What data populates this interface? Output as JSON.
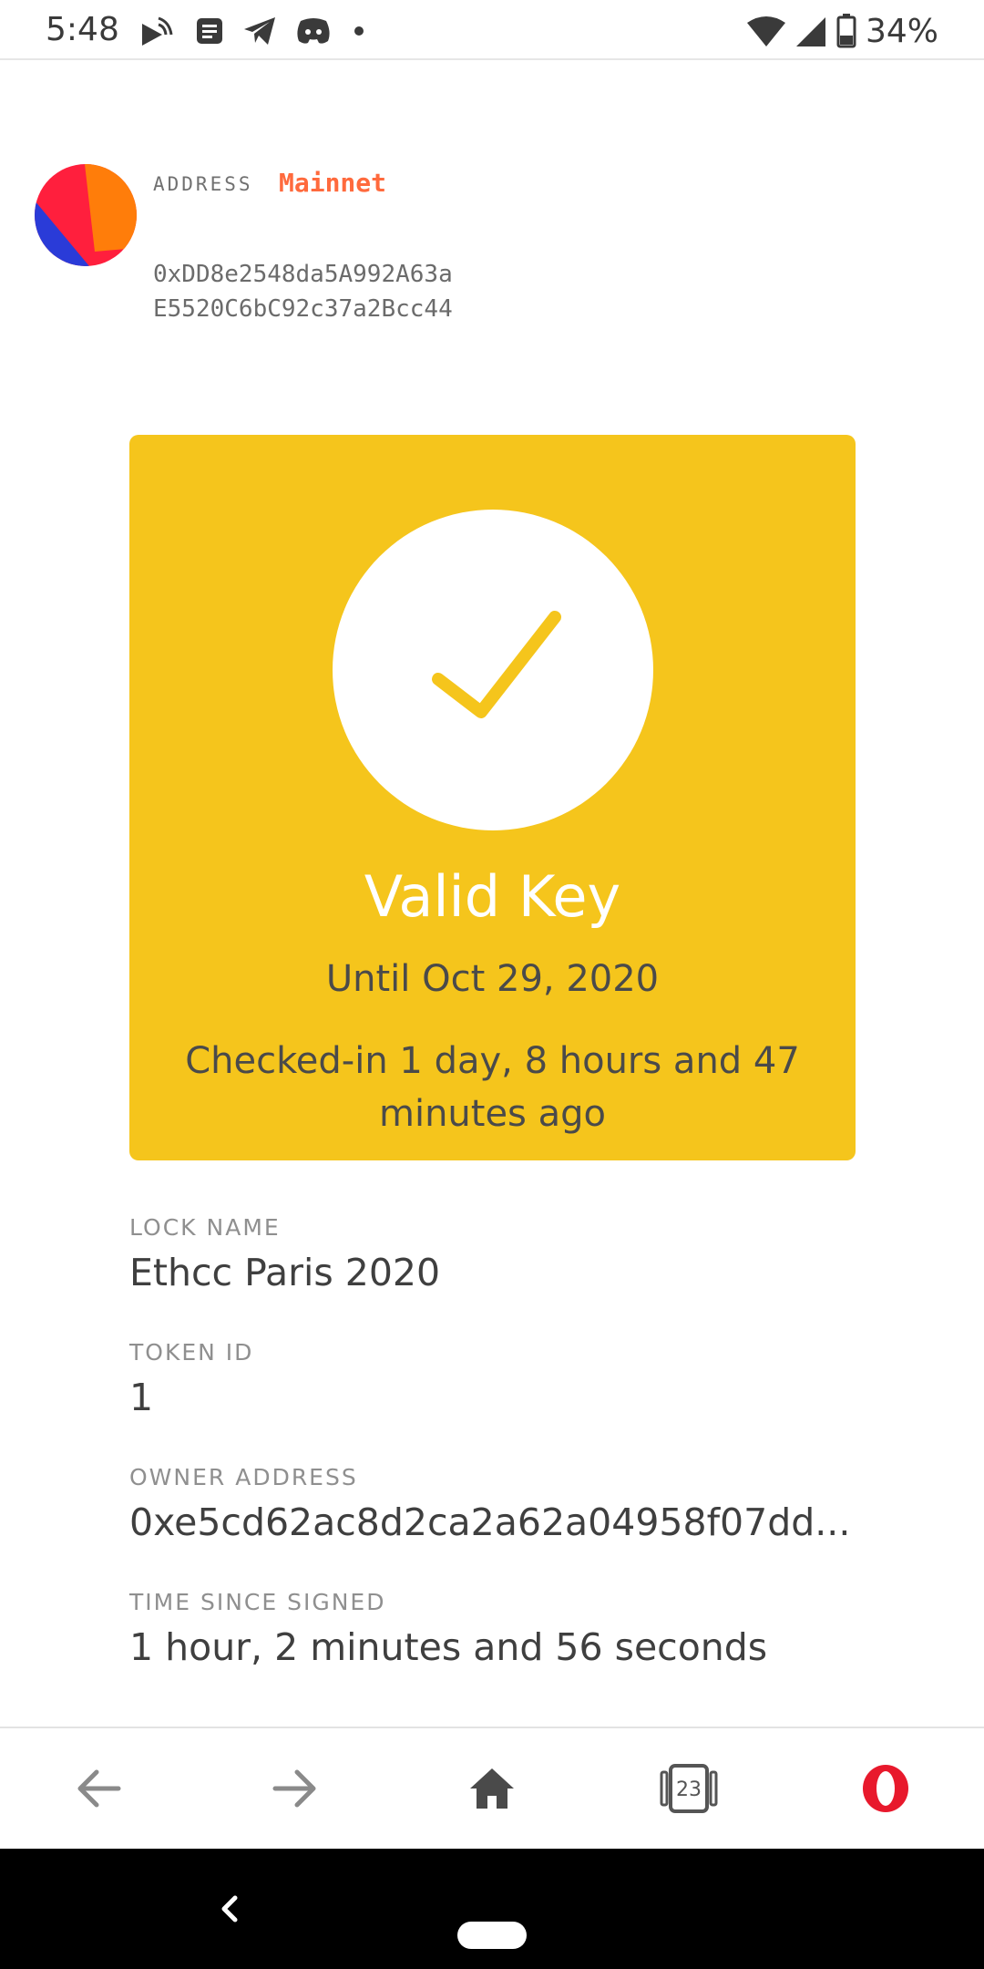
{
  "status_bar": {
    "time": "5:48",
    "battery_text": "34%",
    "icons": [
      "cast-icon",
      "news-icon",
      "telegram-icon",
      "discord-icon",
      "dot-icon",
      "wifi-icon",
      "signal-icon",
      "battery-icon"
    ]
  },
  "header": {
    "address_label": "ADDRESS",
    "network": "Mainnet",
    "address_line1": "0xDD8e2548da5A992A63a",
    "address_line2": "E5520C6bC92c37a2Bcc44"
  },
  "key_card": {
    "status": "Valid Key",
    "expiry": "Until Oct 29, 2020",
    "checkin": "Checked-in 1 day, 8 hours and 47 minutes ago",
    "color": "#f5c51c"
  },
  "details": [
    {
      "label": "LOCK NAME",
      "value": "Ethcc Paris 2020"
    },
    {
      "label": "TOKEN ID",
      "value": "1"
    },
    {
      "label": "OWNER ADDRESS",
      "value": "0xe5cd62ac8d2ca2a62a04958f07dd..."
    },
    {
      "label": "TIME SINCE SIGNED",
      "value": "1 hour, 2 minutes and 56 seconds"
    }
  ],
  "browser_bar": {
    "tab_count": "23",
    "icons": [
      "back-arrow-icon",
      "forward-arrow-icon",
      "home-icon",
      "tabs-icon",
      "opera-menu-icon"
    ]
  }
}
